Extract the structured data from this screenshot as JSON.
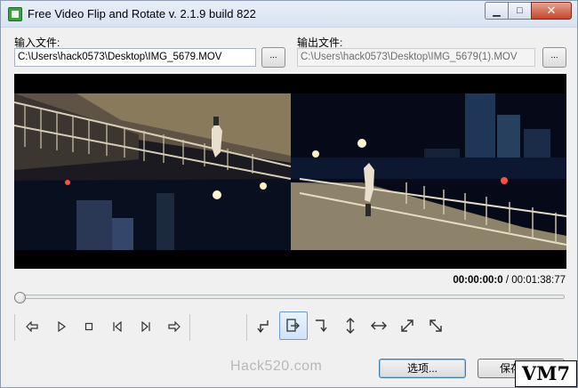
{
  "window": {
    "title": "Free Video Flip and Rotate  v. 2.1.9 build 822",
    "controls": {
      "minimize": "▁",
      "maximize": "□",
      "close": "✕"
    }
  },
  "input": {
    "label": "输入文件:",
    "value": "C:\\Users\\hack0573\\Desktop\\IMG_5679.MOV",
    "browse_label": "..."
  },
  "output": {
    "label": "输出文件:",
    "value": "C:\\Users\\hack0573\\Desktop\\IMG_5679(1).MOV",
    "browse_label": "..."
  },
  "player": {
    "current_time": "00:00:00:0",
    "separator": " / ",
    "total_time": "00:01:38:77",
    "seek_position": 0
  },
  "playback_icons": [
    "prev-frame-icon",
    "play-icon",
    "stop-icon",
    "skip-start-icon",
    "skip-end-icon",
    "next-frame-icon"
  ],
  "transform_icons": [
    "rotate-left-icon",
    "rotate-right-icon",
    "rotate-180-icon",
    "flip-vertical-icon",
    "flip-horizontal-icon",
    "transpose-icon",
    "transverse-icon"
  ],
  "footer": {
    "watermark": "Hack520.com",
    "options_label": "选项...",
    "save_label": "保存视频",
    "badge": "VM7"
  },
  "colors": {
    "accent": "#3c7fb1",
    "video_bg": "#000000"
  }
}
